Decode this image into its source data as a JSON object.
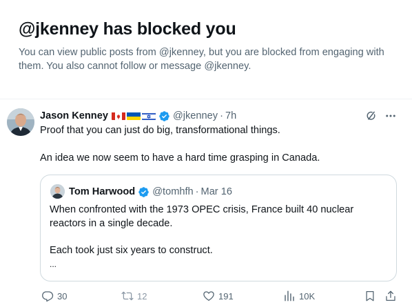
{
  "banner": {
    "title": "@jkenney has blocked you",
    "description": "You can view public posts from @jkenney, but you are blocked from engaging with them. You also cannot follow or message @jkenney."
  },
  "tweet": {
    "author_name": "Jason Kenney",
    "flags": [
      "canada-flag",
      "ukraine-flag",
      "israel-flag"
    ],
    "handle": "@jkenney",
    "separator": "·",
    "time": "7h",
    "text_line1": "Proof that you can just do big, transformational things.",
    "text_line2": "An idea we now seem to have a hard time grasping in Canada.",
    "quote": {
      "author_name": "Tom Harwood",
      "handle": "@tomhfh",
      "separator": "·",
      "date": "Mar 16",
      "line1": "When confronted with the 1973 OPEC crisis, France built 40 nuclear",
      "line2": "reactors in a single decade.",
      "line3": "Each took just six years to construct.",
      "line4": "..."
    },
    "actions": {
      "replies": "30",
      "reposts": "12",
      "likes": "191",
      "views": "10K"
    }
  },
  "colors": {
    "text_primary": "#0f1419",
    "text_secondary": "#536471",
    "verified_blue": "#1d9bf0",
    "border": "#cfd9de"
  }
}
